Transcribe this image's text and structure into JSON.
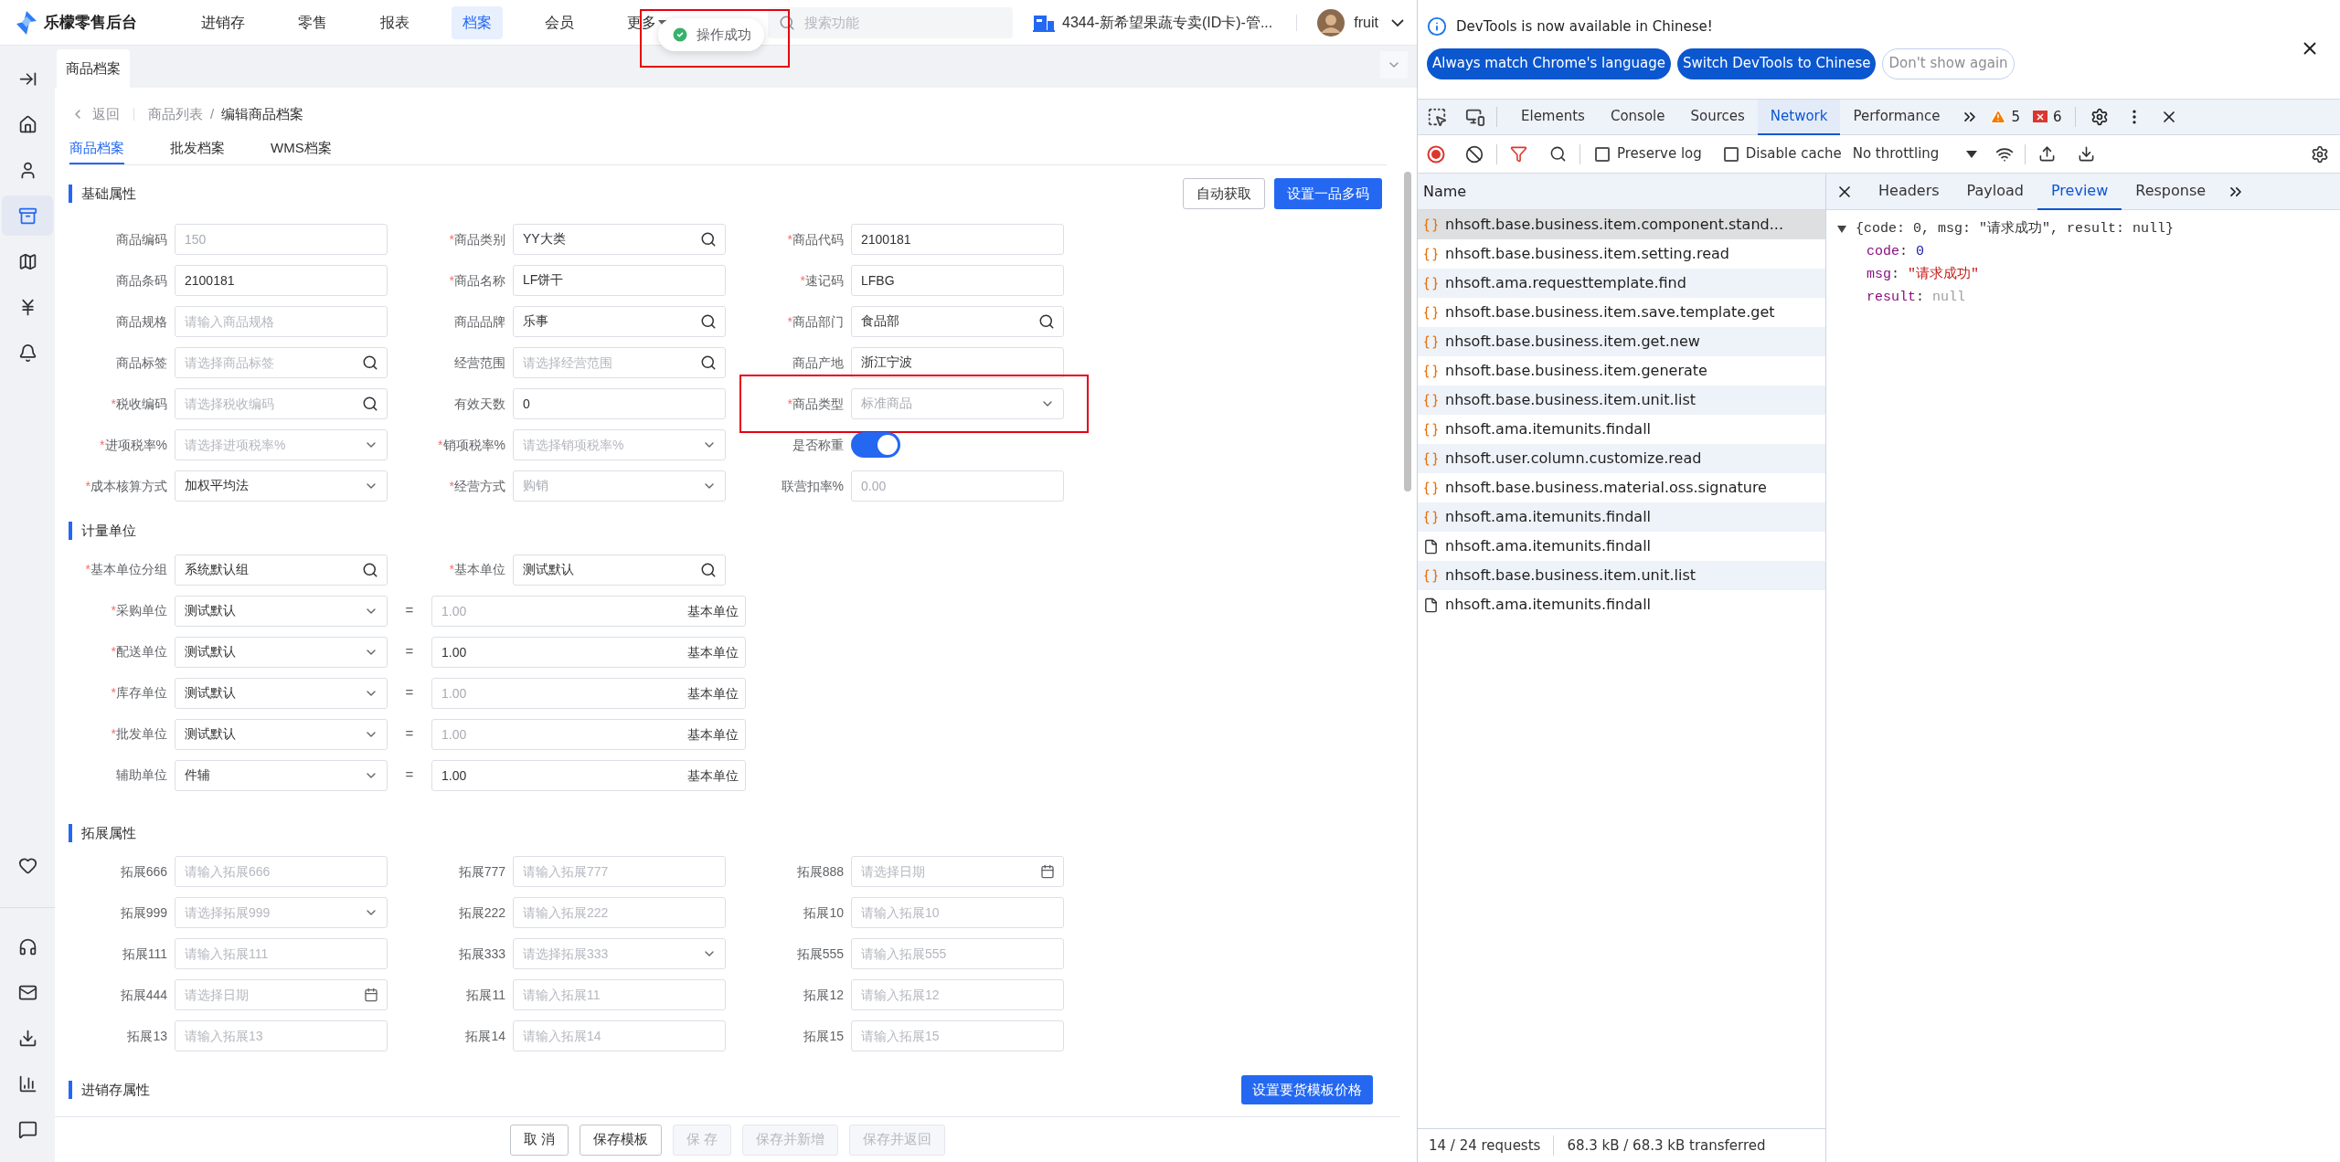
{
  "header": {
    "logo": "乐檬零售后台",
    "nav": [
      {
        "label": "进销存",
        "selected": false
      },
      {
        "label": "零售",
        "selected": false
      },
      {
        "label": "报表",
        "selected": false
      },
      {
        "label": "档案",
        "selected": true
      },
      {
        "label": "会员",
        "selected": false
      },
      {
        "label": "更多",
        "selected": false,
        "kind": "dropdown"
      }
    ],
    "toast": {
      "text": "操作成功",
      "highlighted": true
    },
    "search": {
      "placeholder": "搜索功能"
    },
    "store": "4344-新希望果蔬专卖(ID卡)-管...",
    "user": "fruit"
  },
  "sidebar": {
    "items": [
      {
        "selected": false
      },
      {
        "selected": false
      },
      {
        "selected": false
      },
      {
        "selected": true
      },
      {
        "selected": false
      },
      {
        "selected": false
      },
      {
        "selected": false
      },
      {
        "selected": false
      },
      {
        "selected": false
      },
      {
        "selected": false
      },
      {
        "selected": false
      },
      {
        "selected": false
      },
      {
        "selected": false
      }
    ]
  },
  "page_tabs": [
    {
      "label": "商品档案",
      "selected": true
    }
  ],
  "breadcrumb": {
    "back": "返回",
    "items": [
      "商品列表",
      "编辑商品档案"
    ],
    "separator": "/"
  },
  "form_tabs": [
    {
      "label": "商品档案",
      "selected": true
    },
    {
      "label": "批发档案",
      "selected": false
    },
    {
      "label": "WMS档案",
      "selected": false
    }
  ],
  "basic": {
    "title": "基础属性",
    "actions": [
      {
        "label": "自动获取",
        "kind": "secondary"
      },
      {
        "label": "设置一品多码",
        "kind": "primary"
      }
    ],
    "fields": [
      {
        "label": "商品编码",
        "kind": "text",
        "value": "150",
        "disabled": true
      },
      {
        "label": "商品类别",
        "marker": "*",
        "kind": "search",
        "value": "YY大类",
        "disabled": false
      },
      {
        "label": "商品代码",
        "marker": "*",
        "kind": "text",
        "value": "2100181",
        "disabled": false
      },
      {
        "label": "商品条码",
        "kind": "text",
        "value": "2100181",
        "disabled": false
      },
      {
        "label": "商品名称",
        "marker": "*",
        "kind": "text",
        "value": "LF饼干",
        "disabled": false
      },
      {
        "label": "速记码",
        "marker": "*",
        "kind": "text",
        "value": "LFBG",
        "disabled": false
      },
      {
        "label": "商品规格",
        "kind": "text",
        "placeholder": "请输入商品规格"
      },
      {
        "label": "商品品牌",
        "kind": "search",
        "value": "乐事",
        "disabled": false
      },
      {
        "label": "商品部门",
        "marker": "*",
        "kind": "search",
        "value": "食品部",
        "disabled": false
      },
      {
        "label": "商品标签",
        "kind": "search",
        "placeholder": "请选择商品标签"
      },
      {
        "label": "经营范围",
        "kind": "search",
        "placeholder": "请选择经营范围"
      },
      {
        "label": "商品产地",
        "kind": "text",
        "value": "浙江宁波",
        "disabled": false
      },
      {
        "label": "税收编码",
        "marker": "*",
        "kind": "search",
        "placeholder": "请选择税收编码"
      },
      {
        "label": "有效天数",
        "kind": "text",
        "value": "0",
        "disabled": false
      },
      {
        "label": "商品类型",
        "marker": "*",
        "kind": "select",
        "value": "标准商品",
        "disabled": true,
        "highlighted": true
      },
      {
        "label": "进项税率%",
        "marker": "*",
        "kind": "select",
        "placeholder": "请选择进项税率%"
      },
      {
        "label": "销项税率%",
        "marker": "*",
        "kind": "select",
        "placeholder": "请选择销项税率%"
      },
      {
        "label": "是否称重",
        "kind": "toggle",
        "on": true
      },
      {
        "label": "成本核算方式",
        "marker": "*",
        "kind": "select",
        "value": "加权平均法",
        "disabled": false
      },
      {
        "label": "经营方式",
        "marker": "*",
        "kind": "select",
        "value": "购销",
        "disabled": true
      },
      {
        "label": "联营扣率%",
        "kind": "text",
        "value": "0.00",
        "disabled": true
      }
    ]
  },
  "units": {
    "title": "计量单位",
    "fields": [
      {
        "label": "基本单位分组",
        "marker": "*",
        "kind": "search",
        "value": "系统默认组",
        "disabled": false
      },
      {
        "label": "基本单位",
        "marker": "*",
        "kind": "search",
        "value": "测试默认",
        "disabled": false
      }
    ],
    "conversions": [
      {
        "label": "采购单位",
        "marker": "*",
        "unit": "测试默认",
        "equals": "=",
        "ratio": "1.00",
        "ratio_disabled": true,
        "base": "基本单位"
      },
      {
        "label": "配送单位",
        "marker": "*",
        "unit": "测试默认",
        "equals": "=",
        "ratio": "1.00",
        "ratio_disabled": false,
        "base": "基本单位"
      },
      {
        "label": "库存单位",
        "marker": "*",
        "unit": "测试默认",
        "equals": "=",
        "ratio": "1.00",
        "ratio_disabled": true,
        "base": "基本单位"
      },
      {
        "label": "批发单位",
        "marker": "*",
        "unit": "测试默认",
        "equals": "=",
        "ratio": "1.00",
        "ratio_disabled": true,
        "base": "基本单位"
      },
      {
        "label": "辅助单位",
        "unit": "件辅",
        "equals": "=",
        "ratio": "1.00",
        "ratio_disabled": false,
        "base": "基本单位"
      }
    ]
  },
  "extension": {
    "title": "拓展属性",
    "fields": [
      {
        "label": "拓展666",
        "kind": "text",
        "placeholder": "请输入拓展666"
      },
      {
        "label": "拓展777",
        "kind": "text",
        "placeholder": "请输入拓展777"
      },
      {
        "label": "拓展888",
        "kind": "date",
        "placeholder": "请选择日期"
      },
      {
        "label": "拓展999",
        "kind": "select",
        "placeholder": "请选择拓展999"
      },
      {
        "label": "拓展222",
        "kind": "text",
        "placeholder": "请输入拓展222"
      },
      {
        "label": "拓展10",
        "kind": "text",
        "placeholder": "请输入拓展10"
      },
      {
        "label": "拓展111",
        "kind": "text",
        "placeholder": "请输入拓展111"
      },
      {
        "label": "拓展333",
        "kind": "select",
        "placeholder": "请选择拓展333"
      },
      {
        "label": "拓展555",
        "kind": "text",
        "placeholder": "请输入拓展555"
      },
      {
        "label": "拓展444",
        "kind": "date",
        "placeholder": "请选择日期"
      },
      {
        "label": "拓展11",
        "kind": "text",
        "placeholder": "请输入拓展11"
      },
      {
        "label": "拓展12",
        "kind": "text",
        "placeholder": "请输入拓展12"
      },
      {
        "label": "拓展13",
        "kind": "text",
        "placeholder": "请输入拓展13"
      },
      {
        "label": "拓展14",
        "kind": "text",
        "placeholder": "请输入拓展14"
      },
      {
        "label": "拓展15",
        "kind": "text",
        "placeholder": "请输入拓展15"
      }
    ]
  },
  "inventory": {
    "title": "进销存属性",
    "action": "设置要货模板价格"
  },
  "footer": {
    "buttons": [
      {
        "label": "取 消",
        "disabled": false
      },
      {
        "label": "保存模板",
        "disabled": false
      },
      {
        "label": "保 存",
        "disabled": true
      },
      {
        "label": "保存并新增",
        "disabled": true
      },
      {
        "label": "保存并返回",
        "disabled": true
      }
    ]
  },
  "devtools": {
    "infobar": {
      "message": "DevTools is now available in Chinese!",
      "buttons": [
        {
          "label": "Always match Chrome's language",
          "kind": "primary"
        },
        {
          "label": "Switch DevTools to Chinese",
          "kind": "primary"
        },
        {
          "label": "Don't show again",
          "kind": "secondary"
        }
      ]
    },
    "tabs": [
      {
        "label": "Elements",
        "selected": false
      },
      {
        "label": "Console",
        "selected": false
      },
      {
        "label": "Sources",
        "selected": false
      },
      {
        "label": "Network",
        "selected": true
      },
      {
        "label": "Performance",
        "selected": false
      }
    ],
    "warnings": "5",
    "errors": "6",
    "toolbar": {
      "preserve_log": {
        "label": "Preserve log",
        "checked": false
      },
      "disable_cache": {
        "label": "Disable cache",
        "checked": false
      },
      "throttling": "No throttling"
    },
    "requests": {
      "column": "Name",
      "rows": [
        {
          "name": "nhsoft.base.business.item.component.stand...",
          "kind": "xhr",
          "selected": true
        },
        {
          "name": "nhsoft.base.business.item.setting.read",
          "kind": "xhr",
          "selected": false
        },
        {
          "name": "nhsoft.ama.requesttemplate.find",
          "kind": "xhr",
          "selected": false
        },
        {
          "name": "nhsoft.base.business.item.save.template.get",
          "kind": "xhr",
          "selected": false
        },
        {
          "name": "nhsoft.base.business.item.get.new",
          "kind": "xhr",
          "selected": false
        },
        {
          "name": "nhsoft.base.business.item.generate",
          "kind": "xhr",
          "selected": false
        },
        {
          "name": "nhsoft.base.business.item.unit.list",
          "kind": "xhr",
          "selected": false
        },
        {
          "name": "nhsoft.ama.itemunits.findall",
          "kind": "xhr",
          "selected": false
        },
        {
          "name": "nhsoft.user.column.customize.read",
          "kind": "xhr",
          "selected": false
        },
        {
          "name": "nhsoft.base.business.material.oss.signature",
          "kind": "xhr",
          "selected": false
        },
        {
          "name": "nhsoft.ama.itemunits.findall",
          "kind": "xhr",
          "selected": false
        },
        {
          "name": "nhsoft.ama.itemunits.findall",
          "kind": "doc",
          "selected": false
        },
        {
          "name": "nhsoft.base.business.item.unit.list",
          "kind": "xhr",
          "selected": false
        },
        {
          "name": "nhsoft.ama.itemunits.findall",
          "kind": "doc",
          "selected": false
        }
      ]
    },
    "detail_tabs": [
      {
        "label": "Headers",
        "selected": false
      },
      {
        "label": "Payload",
        "selected": false
      },
      {
        "label": "Preview",
        "selected": true
      },
      {
        "label": "Response",
        "selected": false
      }
    ],
    "preview": {
      "summary": "{code: 0, msg: \"请求成功\", result: null}",
      "expanded": true,
      "fields": [
        {
          "key": "code",
          "colon": ":",
          "value": "0",
          "kind": "number"
        },
        {
          "key": "msg",
          "colon": ":",
          "value": "\"请求成功\"",
          "kind": "string"
        },
        {
          "key": "result",
          "colon": ":",
          "value": "null",
          "kind": "null"
        }
      ]
    },
    "status": {
      "requests": "14 / 24 requests",
      "transferred": "68.3 kB / 68.3 kB transferred"
    }
  }
}
